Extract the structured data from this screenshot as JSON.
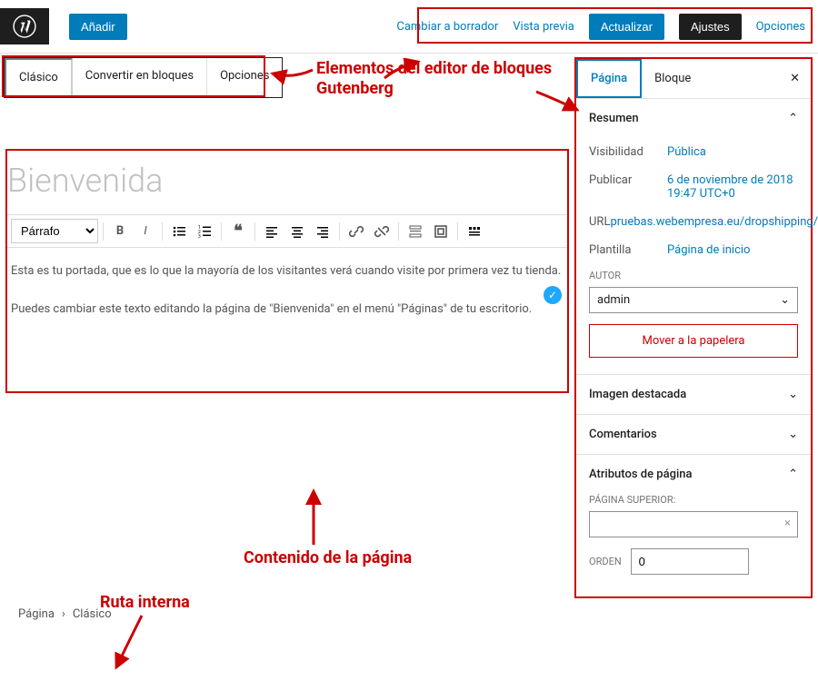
{
  "topbar": {
    "add_label": "Añadir",
    "draft_label": "Cambiar a borrador",
    "preview_label": "Vista previa",
    "update_label": "Actualizar",
    "settings_label": "Ajustes",
    "options_label": "Opciones"
  },
  "block_toolbar": {
    "classic": "Clásico",
    "convert": "Convertir en bloques",
    "options": "Opciones"
  },
  "annotations": {
    "gutenberg": "Elementos del editor de bloques Gutenberg",
    "content": "Contenido de la página",
    "breadcrumb": "Ruta interna"
  },
  "editor": {
    "title": "Bienvenida",
    "format_select": "Párrafo",
    "body1": "Esta es tu portada, que es lo que la mayoría de los visitantes verá cuando visite por primera vez tu tienda.",
    "body2": "Puedes cambiar este texto editando la página de \"Bienvenida\" en el menú \"Páginas\" de tu escritorio."
  },
  "sidebar": {
    "tab_page": "Página",
    "tab_block": "Bloque",
    "summary": {
      "title": "Resumen",
      "visibility_label": "Visibilidad",
      "visibility_value": "Pública",
      "publish_label": "Publicar",
      "publish_value": "6 de noviembre de 2018 19:47 UTC+0",
      "url_label": "URL",
      "url_value": "pruebas.webempresa.eu/dropshipping/",
      "template_label": "Plantilla",
      "template_value": "Página de inicio",
      "author_label": "AUTOR",
      "author_value": "admin",
      "trash": "Mover a la papelera"
    },
    "featured_image": "Imagen destacada",
    "comments": "Comentarios",
    "page_attrs": {
      "title": "Atributos de página",
      "parent_label": "PÁGINA SUPERIOR:",
      "order_label": "ORDEN",
      "order_value": "0"
    }
  },
  "breadcrumb": {
    "page": "Página",
    "classic": "Clásico"
  }
}
